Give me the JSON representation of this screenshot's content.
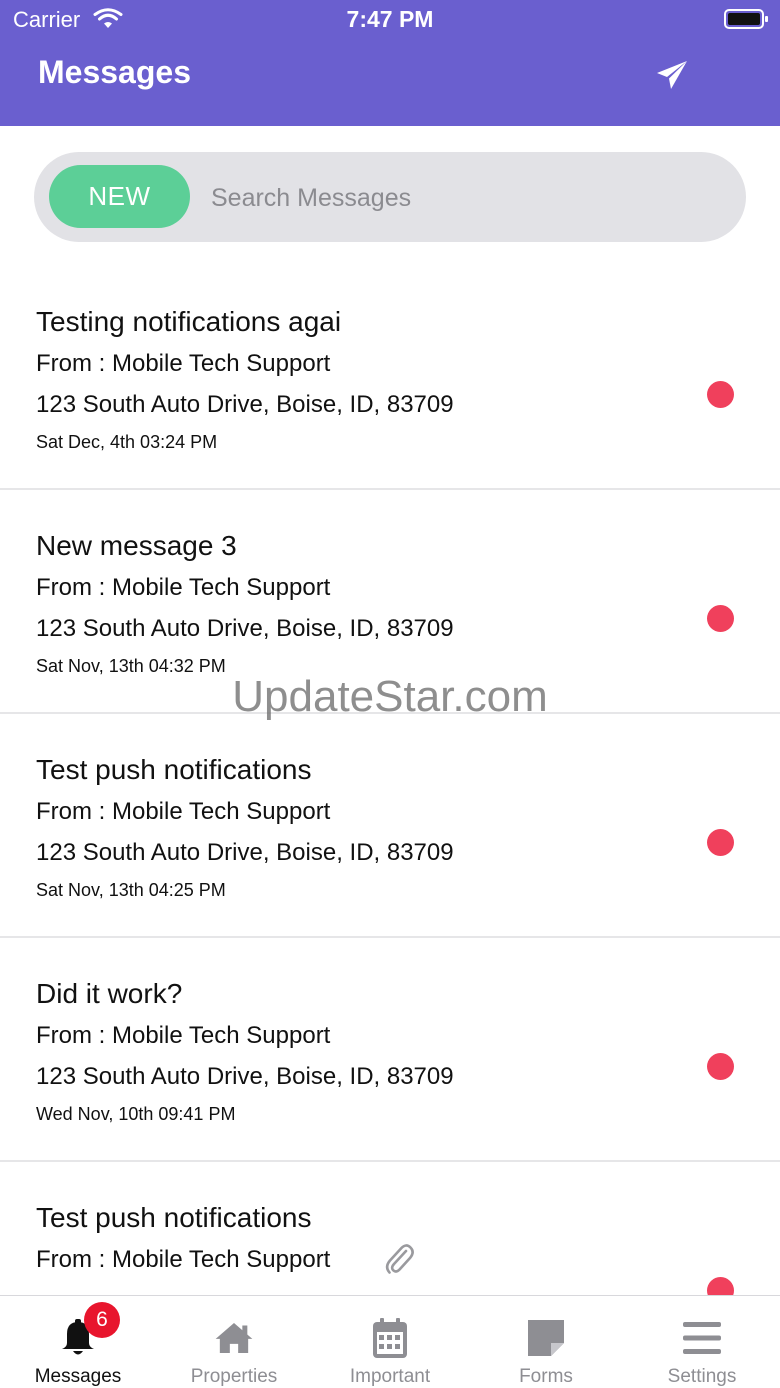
{
  "status_bar": {
    "carrier": "Carrier",
    "time": "7:47 PM"
  },
  "header": {
    "title": "Messages",
    "send_icon": "paper-plane-icon"
  },
  "search": {
    "new_label": "NEW",
    "placeholder": "Search Messages",
    "value": ""
  },
  "messages": [
    {
      "subject": "Testing notifications agai",
      "from": "From :  Mobile Tech Support",
      "address": "123 South Auto Drive, Boise, ID, 83709",
      "date": "Sat Dec, 4th 03:24 PM",
      "unread": true
    },
    {
      "subject": "New message 3",
      "from": "From :  Mobile Tech Support",
      "address": "123 South Auto Drive, Boise, ID, 83709",
      "date": "Sat Nov, 13th 04:32 PM",
      "unread": true
    },
    {
      "subject": "Test push notifications",
      "from": "From :  Mobile Tech Support",
      "address": "123 South Auto Drive, Boise, ID, 83709",
      "date": "Sat Nov, 13th 04:25 PM",
      "unread": true
    },
    {
      "subject": "Did it work?",
      "from": "From :  Mobile Tech Support",
      "address": "123 South Auto Drive, Boise, ID, 83709",
      "date": "Wed Nov, 10th 09:41 PM",
      "unread": true
    },
    {
      "subject": "Test push notifications",
      "from": "From :  Mobile Tech Support",
      "has_attachment": true,
      "unread": true
    }
  ],
  "watermark": "UpdateStar.com",
  "tabs": [
    {
      "label": "Messages",
      "icon": "bell-icon",
      "badge": "6",
      "active": true
    },
    {
      "label": "Properties",
      "icon": "home-icon",
      "active": false
    },
    {
      "label": "Important",
      "icon": "calendar-icon",
      "active": false
    },
    {
      "label": "Forms",
      "icon": "form-note-icon",
      "active": false
    },
    {
      "label": "Settings",
      "icon": "menu-lines-icon",
      "active": false
    }
  ],
  "colors": {
    "header_bg": "#6a5fcf",
    "new_button": "#5ccf97",
    "unread_dot": "#f0405c",
    "badge": "#e8152d",
    "tab_inactive": "#8e8e93"
  }
}
